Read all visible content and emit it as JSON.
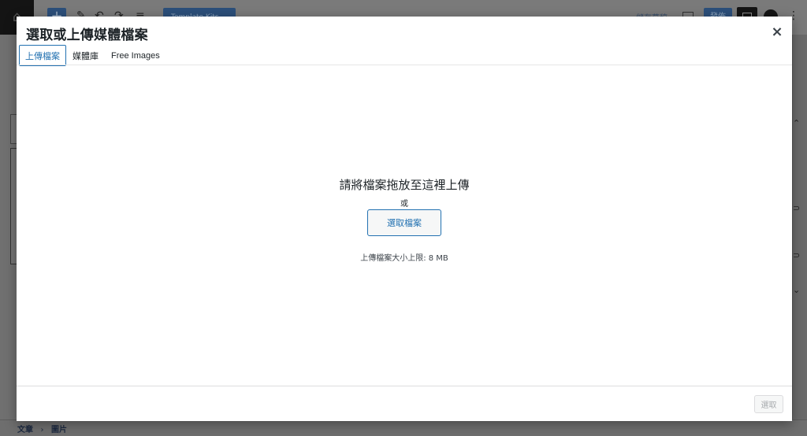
{
  "background": {
    "logo_glyph": "⌂",
    "add_glyph": "+",
    "tools": [
      "✎",
      "↶",
      "↷",
      "≡"
    ],
    "template_kit_label": "Template Kits",
    "save_draft_label": "儲存草稿",
    "publish_label": "發佈",
    "breadcrumb": [
      "文章",
      "›",
      "圖片"
    ]
  },
  "modal": {
    "title": "選取或上傳媒體檔案",
    "close_glyph": "×",
    "tabs": [
      {
        "label": "上傳檔案",
        "active": true
      },
      {
        "label": "媒體庫",
        "active": false
      },
      {
        "label": "Free Images",
        "active": false
      }
    ],
    "uploader": {
      "instructions": "請將檔案拖放至這裡上傳",
      "or_text": "或",
      "select_button": "選取檔案",
      "max_size": "上傳檔案大小上限: 8 MB"
    },
    "select_button_label": "選取"
  },
  "colors": {
    "accent": "#2271b1",
    "overlay": "#6f6f6f",
    "disabled": "#a7aaad"
  }
}
